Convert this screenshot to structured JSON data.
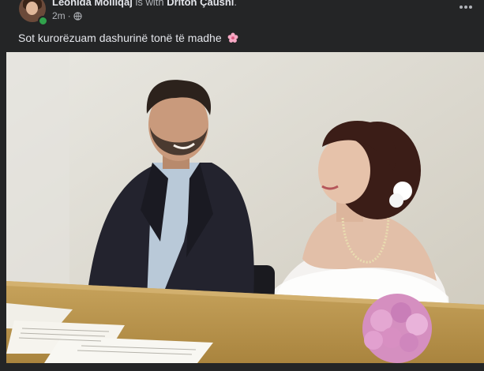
{
  "post": {
    "author": "Leonida Molliqaj",
    "with_text": " is with ",
    "tagged": "Driton Çaushi",
    "tag_end": ".",
    "time": "2m",
    "audience_icon": "globe-icon",
    "menu_icon": "more-horizontal-icon",
    "caption": "Sot kurorëzuam dashurinë tonë të madhe",
    "caption_emoji": "cherry-blossom-icon"
  },
  "colors": {
    "background": "#242526",
    "text_primary": "#e4e6eb",
    "text_secondary": "#b0b3b8",
    "online": "#31a24c"
  },
  "photo": {
    "subject": "wedding-photo"
  }
}
